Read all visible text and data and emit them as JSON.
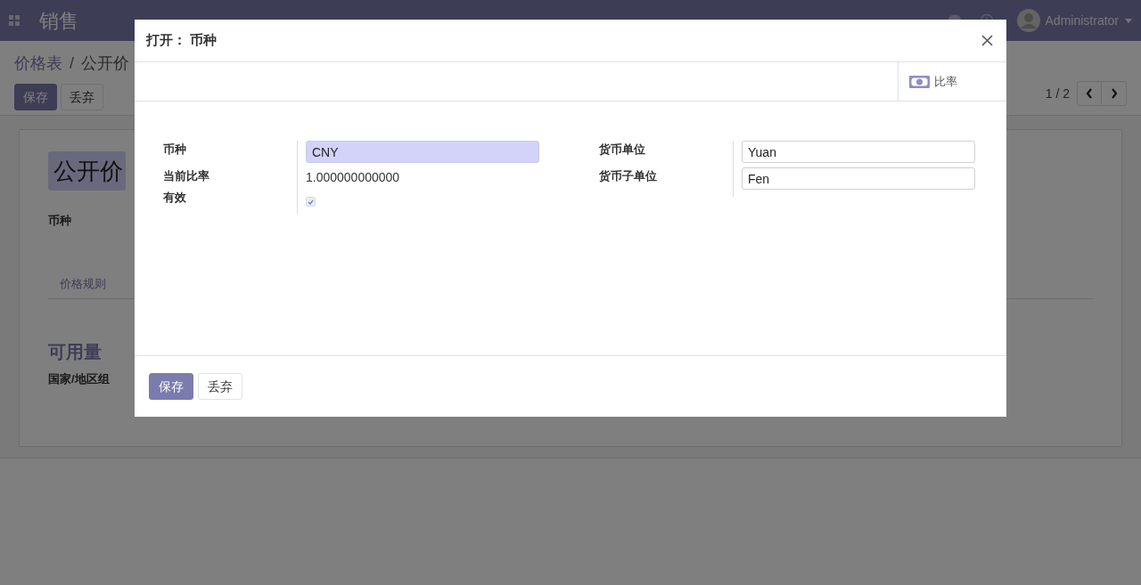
{
  "navbar": {
    "app_name": "销售",
    "user": "Administrator"
  },
  "breadcrumb": [
    "价格表",
    "公开价"
  ],
  "breadcrumb_separator": "/",
  "page_buttons": [
    {
      "label": "保存",
      "kind": "primary"
    },
    {
      "label": "丢弃",
      "kind": "secondary"
    }
  ],
  "pager": {
    "text": "1 / 2"
  },
  "form": {
    "title": "公开价",
    "currency_label": "币种",
    "tabs": [
      {
        "label": "价格规则",
        "selected": false
      }
    ],
    "section_title": "可用量",
    "country_group_label": "国家/地区组"
  },
  "dialog": {
    "title": "打开： 币种",
    "smart_button": {
      "label": "比率"
    },
    "left_fields": [
      {
        "label": "币种",
        "kind": "input",
        "value": "CNY"
      },
      {
        "label": "当前比率",
        "kind": "text",
        "value": "1.000000000000"
      },
      {
        "label": "有效",
        "kind": "checkbox",
        "checked": true
      }
    ],
    "right_fields": [
      {
        "label": "货币单位",
        "kind": "input",
        "value": "Yuan"
      },
      {
        "label": "货币子单位",
        "kind": "input",
        "value": "Fen"
      }
    ],
    "buttons": [
      {
        "label": "保存",
        "kind": "primary"
      },
      {
        "label": "丢弃",
        "kind": "secondary"
      }
    ]
  }
}
